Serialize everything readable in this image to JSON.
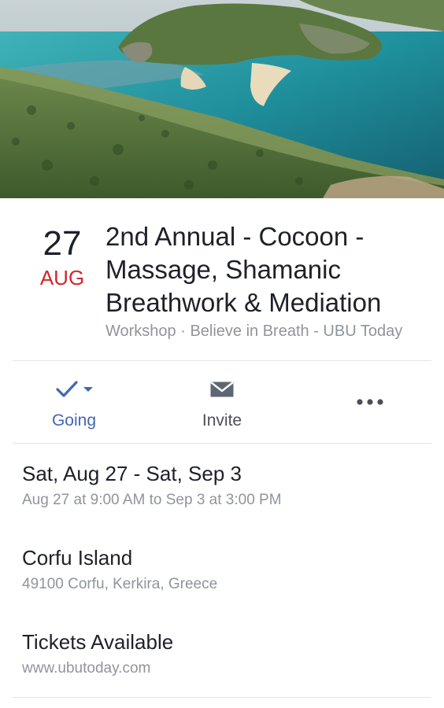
{
  "cover": {
    "image": "coastal-landscape-photo"
  },
  "event": {
    "day": "27",
    "month": "AUG",
    "title": "2nd Annual - Cocoon - Massage, Shamanic Breathwork & Mediation",
    "subtitle": "Workshop · Believe in Breath - UBU Today"
  },
  "actions": {
    "going_label": "Going",
    "invite_label": "Invite",
    "going_icon": "checkmark-icon",
    "invite_icon": "envelope-icon",
    "more_icon": "more-dots-icon"
  },
  "details": {
    "date_main": "Sat, Aug 27 - Sat, Sep 3",
    "date_sub": "Aug 27 at 9:00 AM to Sep 3 at 3:00 PM",
    "location_main": "Corfu Island",
    "location_sub": "49100 Corfu, Kerkira, Greece",
    "tickets_main": "Tickets Available",
    "tickets_sub": "www.ubutoday.com"
  },
  "colors": {
    "accent": "#4267b2",
    "month": "#d2262b",
    "secondary_text": "#90949c",
    "primary_text": "#1d2129"
  }
}
